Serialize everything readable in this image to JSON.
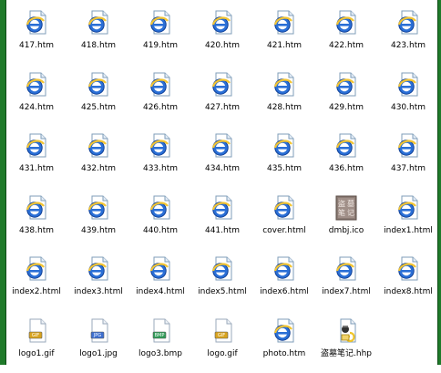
{
  "files": [
    {
      "name": "417.htm",
      "icon": "html-document-icon"
    },
    {
      "name": "418.htm",
      "icon": "html-document-icon"
    },
    {
      "name": "419.htm",
      "icon": "html-document-icon"
    },
    {
      "name": "420.htm",
      "icon": "html-document-icon"
    },
    {
      "name": "421.htm",
      "icon": "html-document-icon"
    },
    {
      "name": "422.htm",
      "icon": "html-document-icon"
    },
    {
      "name": "423.htm",
      "icon": "html-document-icon"
    },
    {
      "name": "424.htm",
      "icon": "html-document-icon"
    },
    {
      "name": "425.htm",
      "icon": "html-document-icon"
    },
    {
      "name": "426.htm",
      "icon": "html-document-icon"
    },
    {
      "name": "427.htm",
      "icon": "html-document-icon"
    },
    {
      "name": "428.htm",
      "icon": "html-document-icon"
    },
    {
      "name": "429.htm",
      "icon": "html-document-icon"
    },
    {
      "name": "430.htm",
      "icon": "html-document-icon"
    },
    {
      "name": "431.htm",
      "icon": "html-document-icon"
    },
    {
      "name": "432.htm",
      "icon": "html-document-icon"
    },
    {
      "name": "433.htm",
      "icon": "html-document-icon"
    },
    {
      "name": "434.htm",
      "icon": "html-document-icon"
    },
    {
      "name": "435.htm",
      "icon": "html-document-icon"
    },
    {
      "name": "436.htm",
      "icon": "html-document-icon"
    },
    {
      "name": "437.htm",
      "icon": "html-document-icon"
    },
    {
      "name": "438.htm",
      "icon": "html-document-icon"
    },
    {
      "name": "439.htm",
      "icon": "html-document-icon"
    },
    {
      "name": "440.htm",
      "icon": "html-document-icon"
    },
    {
      "name": "441.htm",
      "icon": "html-document-icon"
    },
    {
      "name": "cover.html",
      "icon": "html-document-icon"
    },
    {
      "name": "dmbj.ico",
      "icon": "ico-file-icon"
    },
    {
      "name": "index1.html",
      "icon": "html-document-icon"
    },
    {
      "name": "index2.html",
      "icon": "html-document-icon"
    },
    {
      "name": "index3.html",
      "icon": "html-document-icon"
    },
    {
      "name": "index4.html",
      "icon": "html-document-icon"
    },
    {
      "name": "index5.html",
      "icon": "html-document-icon"
    },
    {
      "name": "index6.html",
      "icon": "html-document-icon"
    },
    {
      "name": "index7.html",
      "icon": "html-document-icon"
    },
    {
      "name": "index8.html",
      "icon": "html-document-icon"
    },
    {
      "name": "logo1.gif",
      "icon": "gif-file-icon",
      "badge": "GIF"
    },
    {
      "name": "logo1.jpg",
      "icon": "jpg-file-icon",
      "badge": "JPG"
    },
    {
      "name": "logo3.bmp",
      "icon": "bmp-file-icon",
      "badge": "BMP"
    },
    {
      "name": "logo.gif",
      "icon": "gif-file-icon",
      "badge": "GIF"
    },
    {
      "name": "photo.htm",
      "icon": "html-document-icon"
    },
    {
      "name": "盗墓笔记.hhp",
      "icon": "hhp-file-icon"
    }
  ],
  "ico_glyphs": "盗墓笔记",
  "colors": {
    "frame": "#1f7a2a",
    "ie_blue": "#2a6fd6",
    "gif_badge": "#d8a31e",
    "jpg_badge": "#3d6fd0",
    "bmp_badge": "#2f9b57"
  }
}
